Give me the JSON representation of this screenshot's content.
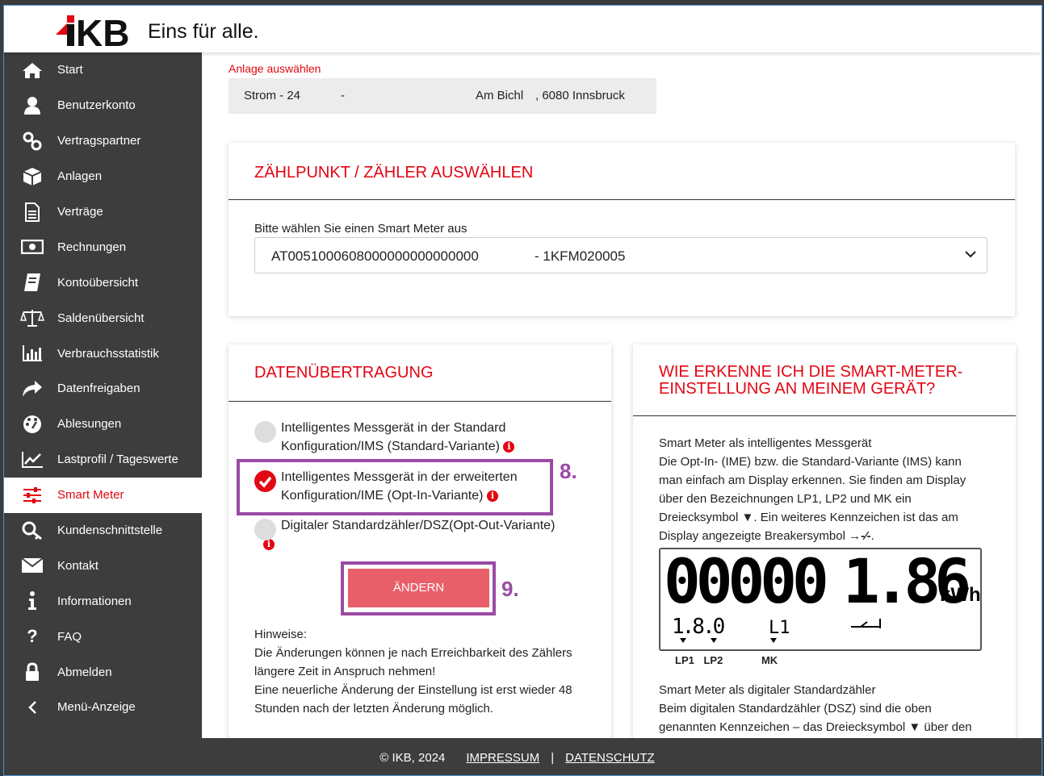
{
  "header": {
    "logo_text": "IKB",
    "tagline": "Eins für alle."
  },
  "sidebar": {
    "items": [
      {
        "label": "Start",
        "icon": "home-icon"
      },
      {
        "label": "Benutzerkonto",
        "icon": "user-icon"
      },
      {
        "label": "Vertragspartner",
        "icon": "link-icon"
      },
      {
        "label": "Anlagen",
        "icon": "cube-icon"
      },
      {
        "label": "Verträge",
        "icon": "document-icon"
      },
      {
        "label": "Rechnungen",
        "icon": "money-icon"
      },
      {
        "label": "Kontoübersicht",
        "icon": "book-icon"
      },
      {
        "label": "Saldenübersicht",
        "icon": "scale-icon"
      },
      {
        "label": "Verbrauchsstatistik",
        "icon": "bar-chart-icon"
      },
      {
        "label": "Datenfreigaben",
        "icon": "share-icon"
      },
      {
        "label": "Ablesungen",
        "icon": "gauge-icon"
      },
      {
        "label": "Lastprofil / Tageswerte",
        "icon": "line-chart-icon"
      },
      {
        "label": "Smart Meter",
        "icon": "sliders-icon",
        "active": true
      },
      {
        "label": "Kundenschnittstelle",
        "icon": "key-icon"
      },
      {
        "label": "Kontakt",
        "icon": "mail-icon"
      },
      {
        "label": "Informationen",
        "icon": "info-icon"
      },
      {
        "label": "FAQ",
        "icon": "question-icon"
      },
      {
        "label": "Abmelden",
        "icon": "lock-icon"
      },
      {
        "label": "Menü-Anzeige",
        "icon": "chevron-left-icon"
      }
    ]
  },
  "anlage": {
    "label": "Anlage auswählen",
    "part1": "Strom - 24",
    "part2": "-",
    "part3": "Am Bichl",
    "part4": ", 6080 Innsbruck"
  },
  "zaehlpunkt": {
    "title": "ZÄHLPUNKT / ZÄHLER AUSWÄHLEN",
    "select_label": "Bitte wählen Sie einen Smart Meter aus",
    "select_value": "AT0051000608000000000000000",
    "select_suffix": "- 1KFM020005"
  },
  "datenuebertragung": {
    "title": "DATENÜBERTRAGUNG",
    "options": [
      {
        "line1": "Intelligentes Messgerät in der Standard",
        "line2": "Konfiguration/IMS (Standard-Variante)",
        "checked": false
      },
      {
        "line1": "Intelligentes Messgerät in der erweiterten",
        "line2": "Konfiguration/IME (Opt-In-Variante)",
        "checked": true
      },
      {
        "line1": "Digitaler Standardzähler/DSZ(Opt-Out-Variante)",
        "line2": "",
        "checked": false
      }
    ],
    "step8": "8.",
    "step9": "9.",
    "button_label": "ÄNDERN",
    "hint_title": "Hinweise:",
    "hint_line1": "Die Änderungen können je nach Erreichbarkeit des Zählers",
    "hint_line2": "längere Zeit in Anspruch nehmen!",
    "hint_line3": "Eine neuerliche Änderung der Einstellung ist erst wieder 48",
    "hint_line4": "Stunden nach der letzten Änderung möglich."
  },
  "info_card": {
    "title_line1": "WIE ERKENNE ICH DIE SMART-METER-",
    "title_line2": "EINSTELLUNG AN MEINEM GERÄT?",
    "sub1": "Smart Meter als intelligentes Messgerät",
    "p1_line1": "Die Opt-In- (IME) bzw. die Standard-Variante (IMS) kann",
    "p1_line2": "man einfach am Display erkennen. Sie finden am Display",
    "p1_line3": "über den Bezeichnungen LP1, LP2 und MK ein",
    "p1_line4a": "Dreiecksymbol",
    "p1_line4b": ". Ein weiteres Kennzeichen ist das am",
    "p1_line5": "Display angezeigte Breakersymbol",
    "lcd_main": "00000",
    "lcd_value": "1.86",
    "lcd_unit": "kWh",
    "lcd_code": "1.8.0",
    "lcd_phase": "L1",
    "lcd_lp1": "LP1",
    "lcd_lp2": "LP2",
    "lcd_mk": "MK",
    "sub2": "Smart Meter als digitaler Standardzähler",
    "p2_line1": "Beim digitalen Standardzähler (DSZ) sind die oben",
    "p2_line2a": "genannten Kennzeichen – das Dreiecksymbol",
    "p2_line2b": "über den"
  },
  "footer": {
    "copyright": "© IKB, 2024",
    "impressum": "IMPRESSUM",
    "separator": "|",
    "datenschutz": "DATENSCHUTZ"
  },
  "colors": {
    "brand_red": "#e30613",
    "button": "#e95f69",
    "highlight": "#9b4aa6",
    "sidebar": "#3d3d3d"
  }
}
